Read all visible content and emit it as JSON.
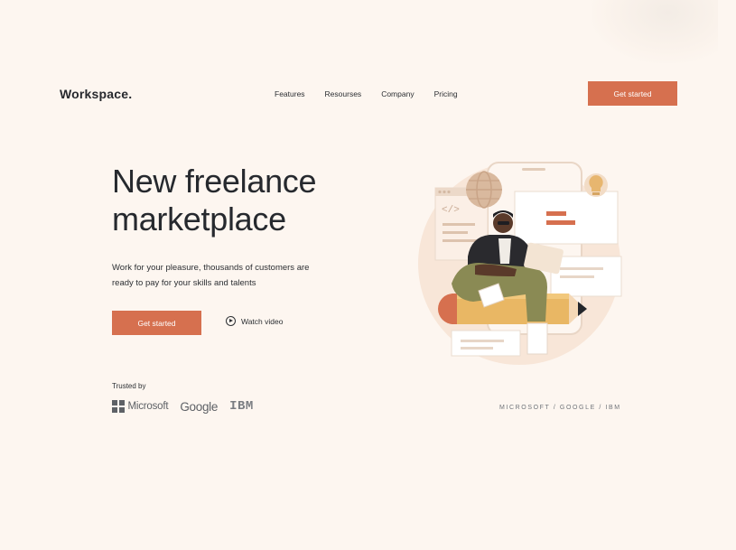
{
  "header": {
    "logo": "Workspace.",
    "nav": [
      "Features",
      "Resourses",
      "Company",
      "Pricing"
    ],
    "cta": "Get started"
  },
  "hero": {
    "title": "New freelance marketplace",
    "subtitle": "Work for your pleasure, thousands of customers are ready to pay for your skills and talents",
    "cta": "Get started",
    "watch_video": "Watch video"
  },
  "trusted": {
    "label": "Trusted by",
    "brands": [
      "Microsoft",
      "Google",
      "IBM"
    ]
  },
  "partners_text": "MICROSOFT / GOOGLE / IBM",
  "colors": {
    "background": "#fdf6f0",
    "accent": "#d6704f",
    "text": "#26292e"
  },
  "icons": [
    "play-icon",
    "microsoft-logo-icon",
    "lightbulb-icon",
    "globe-icon",
    "code-icon"
  ]
}
